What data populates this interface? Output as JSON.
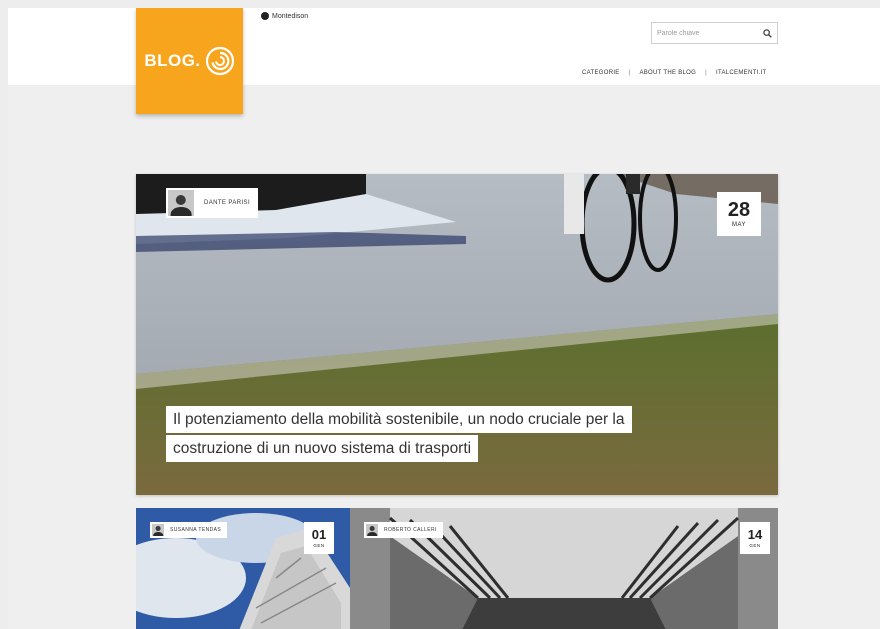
{
  "header": {
    "logo_text": "BLOG.",
    "brand_name": "Montedison",
    "search_placeholder": "Parole chiave",
    "nav": [
      "CATEGORIE",
      "ABOUT THE BLOG",
      "ITALCEMENTI.IT"
    ]
  },
  "featured": {
    "author": "DANTE PARISI",
    "date_day": "28",
    "date_month": "MAY",
    "title_lines": [
      "Il potenziamento della mobilità sostenibile, un nodo cruciale per la",
      "costruzione di un nuovo sistema di trasporti"
    ]
  },
  "cards": [
    {
      "author": "SUSANNA TENDAS",
      "date_day": "01",
      "date_month": "GEN"
    },
    {
      "author": "ROBERTO CALLERI",
      "date_day": "14",
      "date_month": "GEN"
    }
  ],
  "colors": {
    "accent": "#f7a51c",
    "page_bg": "#efefef"
  }
}
